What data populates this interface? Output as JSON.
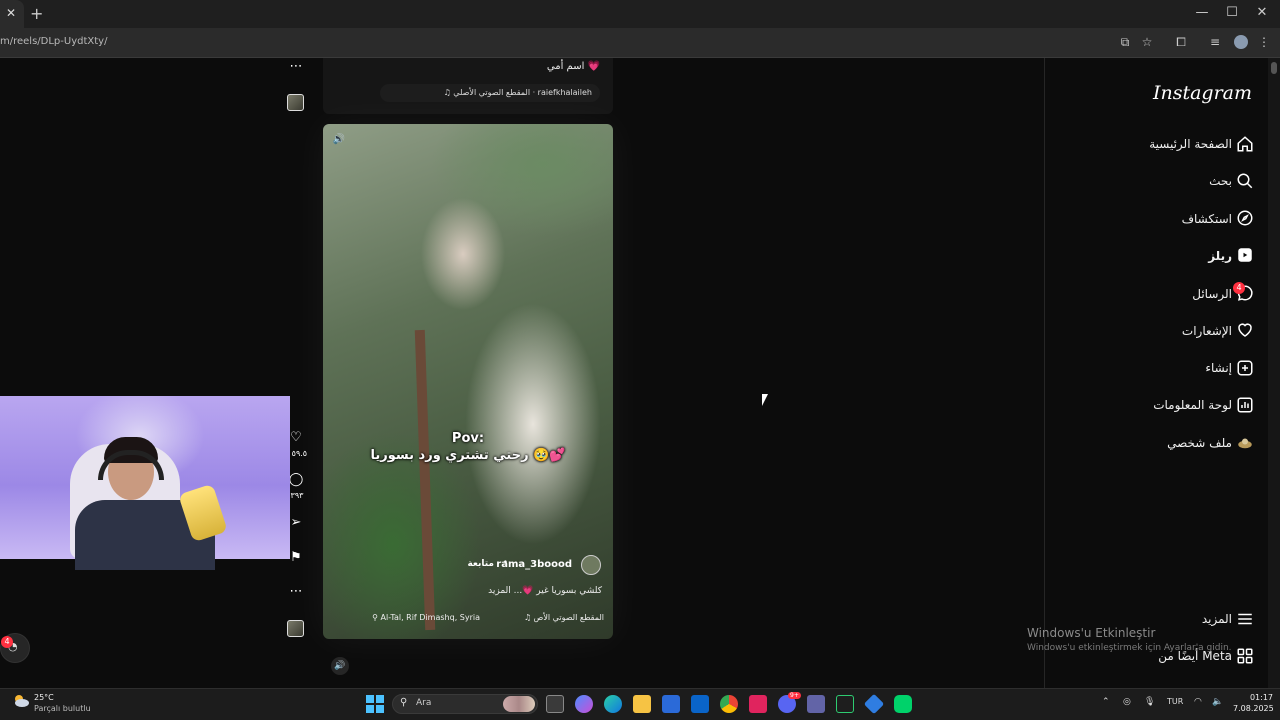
{
  "browser": {
    "url": "m/reels/DLp-UydtXty/",
    "tab_close": "✕",
    "new_tab": "+"
  },
  "instagram": {
    "logo": "Instagram",
    "nav": [
      {
        "label": "الصفحة الرئيسية",
        "icon": "home-icon"
      },
      {
        "label": "بحث",
        "icon": "search-icon"
      },
      {
        "label": "استكشاف",
        "icon": "compass-icon"
      },
      {
        "label": "ريلز",
        "icon": "reels-icon"
      },
      {
        "label": "الرسائل",
        "icon": "messenger-icon",
        "badge": "4"
      },
      {
        "label": "الإشعارات",
        "icon": "heart-icon"
      },
      {
        "label": "إنشاء",
        "icon": "plus-square-icon"
      },
      {
        "label": "لوحة المعلومات",
        "icon": "dashboard-icon"
      },
      {
        "label": "ملف شخصي",
        "icon": "profile-avatar-icon"
      }
    ],
    "more": {
      "label": "المزيد",
      "icon": "menu-icon"
    },
    "also_from_meta": {
      "label": "أيضًا من Meta",
      "icon": "grid-icon"
    }
  },
  "prev_reel": {
    "caption": "اسم أمي 💗",
    "audio": "♫ المقطع الصوتي الأصلي · raiefkhalaileh"
  },
  "reel": {
    "overlay_title": "Pov:",
    "overlay_text": "رحتي تشتري ورد بسوريا 🥹💕",
    "creator": "rama_3boood",
    "follow": "متابعة",
    "separator": "•",
    "caption": "كلشي بسوريا غير 💗... المزيد",
    "audio": "♫ المقطع الصوتي الأص",
    "location": "Al-Tal, Rif Dimashq, Syria",
    "likes": "٥٩.٥ آ",
    "comments": "٣٩٣"
  },
  "floating": {
    "badge": "4"
  },
  "watermark": {
    "title": "Windows'u Etkinleştir",
    "subtitle": "Windows'u etkinleştirmek için Ayarlar'a gidin."
  },
  "taskbar": {
    "temp": "25°C",
    "weather": "Parçalı bulutlu",
    "search": "Ara",
    "lang": "TUR",
    "time": "01:17",
    "date": "7.08.2025",
    "discord_badge": "9+"
  },
  "colors": {
    "accent": "#ff3040",
    "background": "#0c0c0c"
  }
}
